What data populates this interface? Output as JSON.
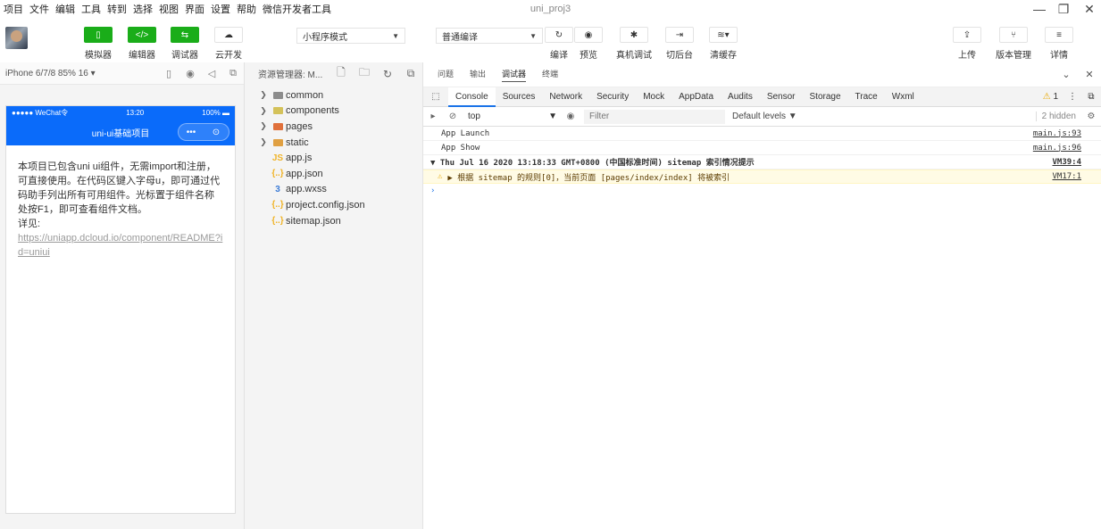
{
  "menu": [
    "项目",
    "文件",
    "编辑",
    "工具",
    "转到",
    "选择",
    "视图",
    "界面",
    "设置",
    "帮助",
    "微信开发者工具"
  ],
  "window_title": "uni_proj3",
  "toolbar": {
    "simulator": "模拟器",
    "editor": "编辑器",
    "debugger": "调试器",
    "cloud": "云开发",
    "mode_select": "小程序模式",
    "compile_select": "普通编译",
    "compile": "编译",
    "preview": "预览",
    "real_debug": "真机调试",
    "background": "切后台",
    "clear_cache": "清缓存",
    "upload": "上传",
    "version": "版本管理",
    "details": "详情",
    "code_icon": "</>"
  },
  "simulator": {
    "device": "iPhone 6/7/8 85% 16 ▾",
    "status_left": "●●●●● WeChat令",
    "status_time": "13:20",
    "status_right": "100%",
    "nav_title": "uni-ui基础项目",
    "capsule_more": "•••",
    "capsule_close": "⊙",
    "body_text": "本项目已包含uni ui组件，无需import和注册，可直接使用。在代码区键入字母u，即可通过代码助手列出所有可用组件。光标置于组件名称处按F1，即可查看组件文档。",
    "detail_label": "详见:",
    "link": "https://uniapp.dcloud.io/component/README?id=uniui"
  },
  "explorer": {
    "title": "资源管理器: M...",
    "items": [
      {
        "name": "common",
        "type": "folder",
        "color": "#8c8c8c"
      },
      {
        "name": "components",
        "type": "folder",
        "color": "#d4c25a"
      },
      {
        "name": "pages",
        "type": "folder",
        "color": "#e0703b"
      },
      {
        "name": "static",
        "type": "folder",
        "color": "#e0a042"
      },
      {
        "name": "app.js",
        "type": "file",
        "icon": "JS",
        "color": "#f0b429"
      },
      {
        "name": "app.json",
        "type": "file",
        "icon": "{..}",
        "color": "#f0b429"
      },
      {
        "name": "app.wxss",
        "type": "file",
        "icon": "3",
        "color": "#3b7bd6"
      },
      {
        "name": "project.config.json",
        "type": "file",
        "icon": "{..}",
        "color": "#f0b429"
      },
      {
        "name": "sitemap.json",
        "type": "file",
        "icon": "{..}",
        "color": "#f0b429"
      }
    ]
  },
  "devtools": {
    "top_tabs": [
      "问题",
      "输出",
      "调试器",
      "终端"
    ],
    "active_top_tab": "调试器",
    "tabs": [
      "Console",
      "Sources",
      "Network",
      "Security",
      "Mock",
      "AppData",
      "Audits",
      "Sensor",
      "Storage",
      "Trace",
      "Wxml"
    ],
    "active_tab": "Console",
    "warning_count": "1",
    "context": "top",
    "filter_placeholder": "Filter",
    "levels": "Default levels ▼",
    "hidden": "2 hidden",
    "logs": [
      {
        "kind": "log",
        "text": "App Launch",
        "source": "main.js:93"
      },
      {
        "kind": "log",
        "text": "App Show",
        "source": "main.js:96"
      },
      {
        "kind": "group",
        "text": "▼ Thu Jul 16 2020 13:18:33 GMT+0800 (中国标准时间) sitemap 索引情况提示",
        "source": "VM39:4"
      },
      {
        "kind": "warn",
        "text": "▶ 根据 sitemap 的规则[0]，当前页面 [pages/index/index] 将被索引",
        "source": "VM17:1"
      }
    ],
    "prompt": "›"
  }
}
